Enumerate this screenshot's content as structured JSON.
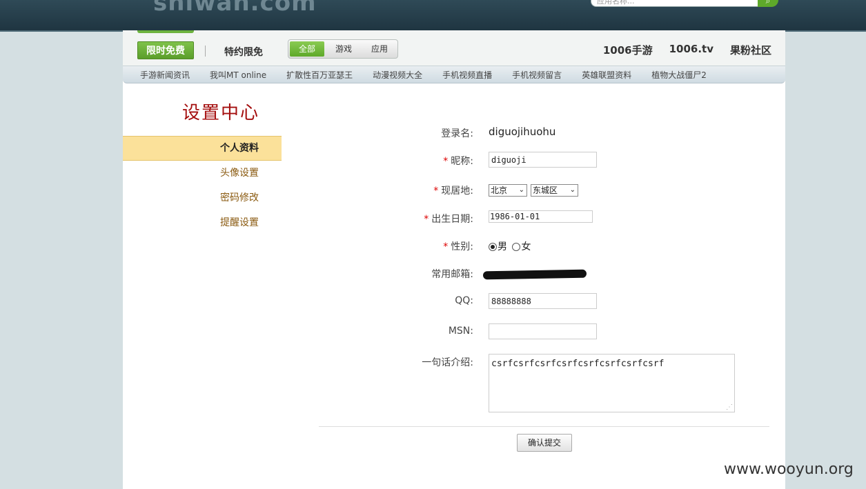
{
  "header": {
    "logo": "shiwan.com",
    "search_placeholder": "应用名称..."
  },
  "nav": {
    "free_label": "限时免费",
    "special_label": "特约限免",
    "segments": [
      "全部",
      "游戏",
      "应用"
    ],
    "right_links": [
      "1006手游",
      "1006.tv",
      "果粉社区"
    ],
    "sub_links": [
      "手游新闻资讯",
      "我叫MT online",
      "扩散性百万亚瑟王",
      "动漫视频大全",
      "手机视频直播",
      "手机视频留言",
      "英雄联盟资料",
      "植物大战僵尸2"
    ]
  },
  "sidebar": {
    "title": "设置中心",
    "items": [
      {
        "label": "个人资料",
        "active": true
      },
      {
        "label": "头像设置",
        "active": false
      },
      {
        "label": "密码修改",
        "active": false
      },
      {
        "label": "提醒设置",
        "active": false
      }
    ]
  },
  "form": {
    "login_label": "登录名:",
    "login_value": "diguojihuohu",
    "nickname_label": "昵称:",
    "nickname_value": "diguoji",
    "location_label": "现居地:",
    "province": "北京",
    "district": "东城区",
    "birth_label": "出生日期:",
    "birth_value": "1986-01-01",
    "gender_label": "性别:",
    "gender_male": "男",
    "gender_female": "女",
    "email_label": "常用邮箱:",
    "qq_label": "QQ:",
    "qq_value": "88888888",
    "msn_label": "MSN:",
    "msn_value": "",
    "intro_label": "一句话介绍:",
    "intro_value": "csrfcsrfcsrfcsrfcsrfcsrfcsrfcsrf",
    "submit_label": "确认提交"
  },
  "watermark": "www.wooyun.org"
}
